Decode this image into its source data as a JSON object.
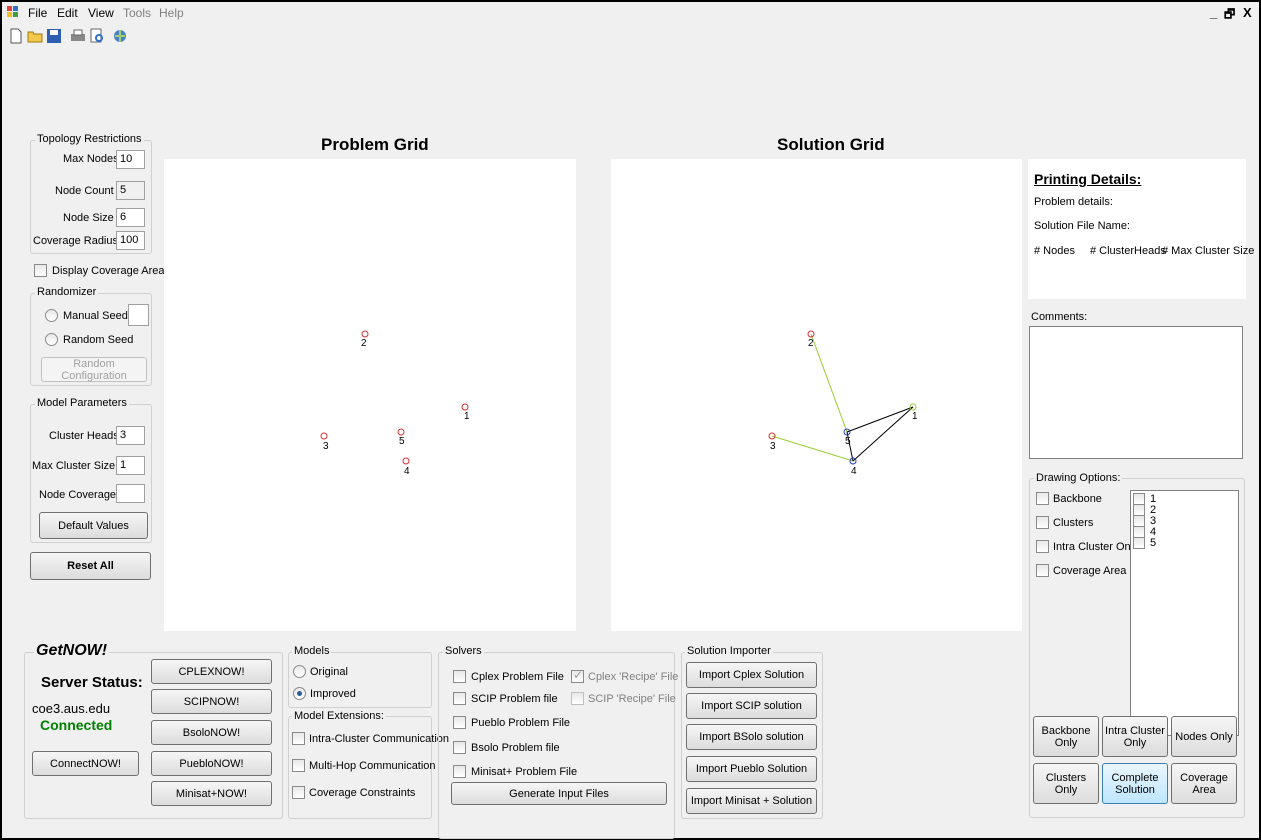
{
  "menu": {
    "file": "File",
    "edit": "Edit",
    "view": "View",
    "tools": "Tools",
    "help": "Help"
  },
  "window_controls": {
    "minimize": "_",
    "maximize": "🗗",
    "close": "X"
  },
  "toolbar_icons": [
    "new-icon",
    "open-icon",
    "save-icon",
    "print-icon",
    "print-preview-icon",
    "web-icon"
  ],
  "topology": {
    "title": "Topology Restrictions",
    "max_nodes_label": "Max Nodes",
    "max_nodes": "10",
    "node_count_label": "Node Count",
    "node_count": "5",
    "node_size_label": "Node Size",
    "node_size": "6",
    "coverage_radius_label": "Coverage Radius",
    "coverage_radius": "100"
  },
  "display_coverage_label": "Display Coverage Area",
  "randomizer": {
    "title": "Randomizer",
    "manual_seed": "Manual Seed",
    "random_seed": "Random Seed",
    "random_config": "Random Configuration"
  },
  "model_params": {
    "title": "Model Parameters",
    "cluster_heads_label": "Cluster Heads",
    "cluster_heads": "3",
    "max_cluster_size_label": "Max Cluster Size",
    "max_cluster_size": "1",
    "node_coverage_label": "Node Coverage",
    "node_coverage": "",
    "default_values": "Default Values"
  },
  "reset_all": "Reset All",
  "problem_grid": {
    "title": "Problem Grid",
    "nodes": [
      {
        "id": "1"
      },
      {
        "id": "2"
      },
      {
        "id": "3"
      },
      {
        "id": "4"
      },
      {
        "id": "5"
      }
    ]
  },
  "solution_grid": {
    "title": "Solution Grid",
    "nodes": [
      {
        "id": "1"
      },
      {
        "id": "2"
      },
      {
        "id": "3"
      },
      {
        "id": "4"
      },
      {
        "id": "5"
      }
    ]
  },
  "printing": {
    "title": "Printing Details:",
    "problem_details": "Problem details:",
    "solution_file": "Solution File Name:",
    "nodes": "# Nodes",
    "cluster_heads": "# ClusterHeads",
    "max_cluster_size": "# Max Cluster Size"
  },
  "comments_label": "Comments:",
  "drawing": {
    "title": "Drawing Options:",
    "backbone": "Backbone",
    "clusters": "Clusters",
    "intra_cluster_only": "Intra Cluster Only",
    "coverage_area": "Coverage Area",
    "node_list": [
      "1",
      "2",
      "3",
      "4",
      "5"
    ]
  },
  "view_buttons": {
    "backbone_only": "Backbone Only",
    "intra_cluster_only": "Intra Cluster Only",
    "nodes_only": "Nodes Only",
    "clusters_only": "Clusters Only",
    "complete_solution": "Complete Solution",
    "coverage_area": "Coverage Area"
  },
  "getnow": {
    "title": "GetNOW!",
    "server_status_label": "Server Status:",
    "server": "coe3.aus.edu",
    "status": "Connected",
    "connect": "ConnectNOW!",
    "cplex": "CPLEXNOW!",
    "scip": "SCIPNOW!",
    "bsolo": "BsoloNOW!",
    "pueblo": "PuebloNOW!",
    "minisat": "Minisat+NOW!"
  },
  "models": {
    "title": "Models",
    "original": "Original",
    "improved": "Improved",
    "ext_title": "Model Extensions:",
    "intra_cluster": "Intra-Cluster Communication",
    "multi_hop": "Multi-Hop Communication",
    "coverage": "Coverage Constraints"
  },
  "solvers": {
    "title": "Solvers",
    "cplex_problem": "Cplex Problem File",
    "cplex_recipe": "Cplex 'Recipe' File",
    "scip_problem": "SCIP Problem file",
    "scip_recipe": "SCIP 'Recipe' File",
    "pueblo_problem": "Pueblo Problem File",
    "bsolo_problem": "Bsolo Problem file",
    "minisat_problem": "Minisat+ Problem File",
    "generate": "Generate Input Files"
  },
  "importer": {
    "title": "Solution Importer",
    "cplex": "Import Cplex Solution",
    "scip": "Import SCIP solution",
    "bsolo": "Import BSolo solution",
    "pueblo": "Import Pueblo Solution",
    "minisat": "Import Minisat + Solution"
  },
  "colors": {
    "node_red": "#d03030",
    "node_blue": "#2040c0",
    "edge_green": "#9acd32",
    "edge_black": "#000000",
    "connected": "#008000"
  }
}
